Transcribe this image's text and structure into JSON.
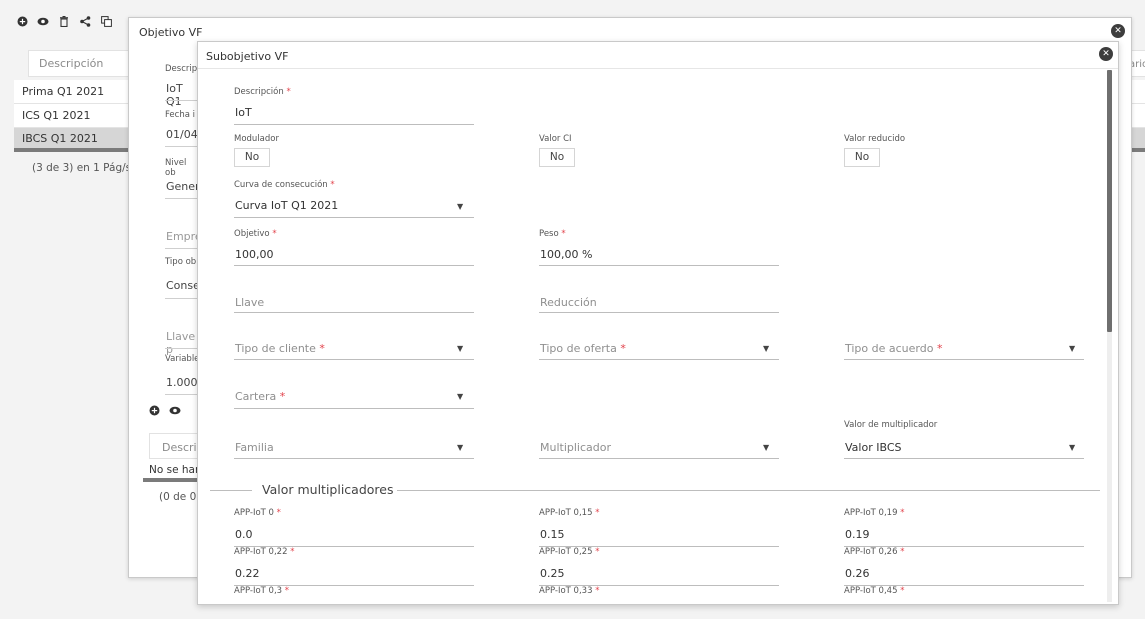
{
  "background": {
    "toolbar_icons": [
      "plus-circle-icon",
      "eye-icon",
      "trash-icon",
      "share-icon",
      "copy-icon"
    ],
    "table_header": "Descripción",
    "rows": [
      "Prima Q1 2021",
      "ICS Q1 2021",
      "IBCS Q1 2021"
    ],
    "selected_row": 2,
    "pager": "(3 de 3) en 1 Pág/s.",
    "right_header_partial": "ario"
  },
  "outer_dialog": {
    "title": "Objetivo VF",
    "fields": [
      {
        "label": "Descrip",
        "value": "IoT Q1"
      },
      {
        "label": "Fecha i",
        "value": "01/04/"
      },
      {
        "label": "Nivel ob",
        "value": "Gener"
      },
      {
        "label": "",
        "placeholder": "Empre"
      },
      {
        "label": "Tipo ob",
        "value": "Conse"
      },
      {
        "label": "",
        "placeholder": "Llave p"
      },
      {
        "label": "Variable",
        "value": "1.000,"
      }
    ],
    "table_header": "Descrip",
    "table_row": "No se han",
    "pager": "(0 de 0)"
  },
  "inner_dialog": {
    "title": "Subobjetivo VF",
    "descripcion": {
      "label": "Descripción",
      "value": "IoT",
      "required": "*"
    },
    "modulador": {
      "label": "Modulador",
      "value": "No"
    },
    "valor_ci": {
      "label": "Valor CI",
      "value": "No"
    },
    "valor_reducido": {
      "label": "Valor reducido",
      "value": "No"
    },
    "curva": {
      "label": "Curva de consecución",
      "value": "Curva IoT Q1 2021",
      "required": "*"
    },
    "objetivo": {
      "label": "Objetivo",
      "value": "100,00",
      "required": "*"
    },
    "peso": {
      "label": "Peso",
      "value": "100,00 %",
      "required": "*"
    },
    "llave": {
      "placeholder": "Llave"
    },
    "reduccion": {
      "placeholder": "Reducción"
    },
    "tipo_cliente": {
      "placeholder": "Tipo de cliente",
      "required": "*"
    },
    "tipo_oferta": {
      "placeholder": "Tipo de oferta",
      "required": "*"
    },
    "tipo_acuerdo": {
      "placeholder": "Tipo de acuerdo",
      "required": "*"
    },
    "cartera": {
      "placeholder": "Cartera",
      "required": "*"
    },
    "familia": {
      "placeholder": "Familia"
    },
    "multiplicador": {
      "placeholder": "Multiplicador"
    },
    "valor_multiplicador": {
      "label": "Valor de multiplicador",
      "value": "Valor IBCS"
    },
    "section_title": "Valor multiplicadores",
    "multipliers": [
      {
        "label": "APP-IoT 0",
        "value": "0.0"
      },
      {
        "label": "APP-IoT 0,15",
        "value": "0.15"
      },
      {
        "label": "APP-IoT 0,19",
        "value": "0.19"
      },
      {
        "label": "APP-IoT 0,22",
        "value": "0.22"
      },
      {
        "label": "APP-IoT 0,25",
        "value": "0.25"
      },
      {
        "label": "APP-IoT 0,26",
        "value": "0.26"
      },
      {
        "label": "APP-IoT 0,3",
        "value": ""
      },
      {
        "label": "APP-IoT 0,33",
        "value": ""
      },
      {
        "label": "APP-IoT 0,45",
        "value": ""
      }
    ],
    "required_mark": "*"
  }
}
